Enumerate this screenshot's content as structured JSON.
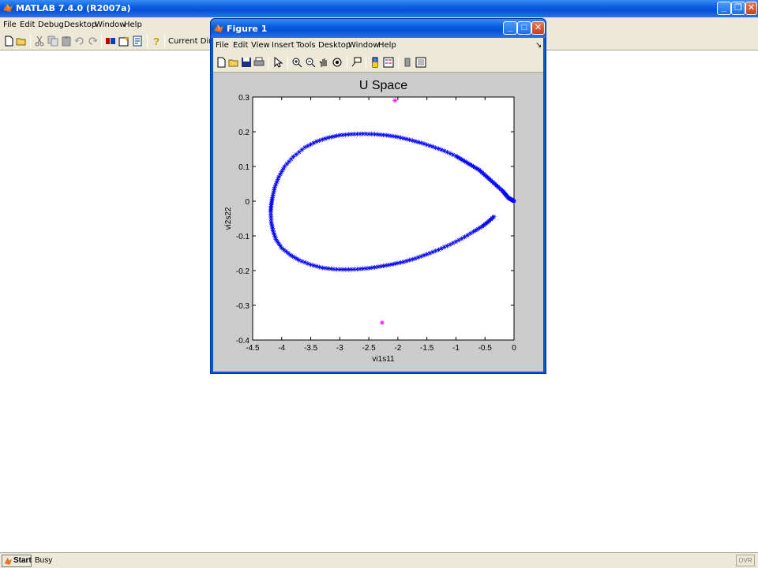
{
  "main_window": {
    "title": "MATLAB  7.4.0 (R2007a)",
    "menu": [
      "File",
      "Edit",
      "Debug",
      "Desktop",
      "Window",
      "Help"
    ],
    "current_directory_label": "Current Directo",
    "toolbar_icons": [
      "new-file-icon",
      "open-folder-icon",
      "cut-icon",
      "copy-icon",
      "paste-icon",
      "undo-icon",
      "redo-icon",
      "simulink-icon",
      "guide-icon",
      "profiler-icon",
      "help-icon"
    ]
  },
  "status_bar": {
    "start_label": "Start",
    "status": "Busy",
    "ovr": "OVR"
  },
  "figure_window": {
    "title": "Figure 1",
    "menu": [
      "File",
      "Edit",
      "View",
      "Insert",
      "Tools",
      "Desktop",
      "Window",
      "Help"
    ],
    "dock_glyph": "↘",
    "toolbar_icons": [
      "new-figure-icon",
      "open-file-icon",
      "save-icon",
      "print-icon",
      "edit-plot-arrow-icon",
      "zoom-in-icon",
      "zoom-out-icon",
      "pan-hand-icon",
      "rotate-3d-icon",
      "data-cursor-icon",
      "insert-colorbar-icon",
      "insert-legend-icon",
      "hide-plot-tools-icon",
      "show-plot-tools-icon"
    ]
  },
  "chart_data": {
    "type": "scatter",
    "title": "U Space",
    "xlabel": "vi1s11",
    "ylabel": "vi2s22",
    "xlim": [
      -4.5,
      0
    ],
    "ylim": [
      -0.4,
      0.3
    ],
    "xticks": [
      "-4.5",
      "-4",
      "-3.5",
      "-3",
      "-2.5",
      "-2",
      "-1.5",
      "-1",
      "-0.5",
      "0"
    ],
    "yticks": [
      "-0.4",
      "-0.3",
      "-0.2",
      "-0.1",
      "0",
      "0.1",
      "0.2",
      "0.3"
    ],
    "grid": false,
    "series": [
      {
        "marker": "*",
        "color": "#0000ff",
        "x": [
          0,
          -0.05,
          -0.1,
          -0.15,
          -0.2,
          -0.3,
          -0.4,
          -0.5,
          -0.6,
          -0.7,
          -0.8,
          -0.9,
          -1.0,
          -1.2,
          -1.4,
          -1.6,
          -1.8,
          -2.0,
          -2.2,
          -2.4,
          -2.6,
          -2.8,
          -3.0,
          -3.2,
          -3.4,
          -3.6,
          -3.8,
          -3.95,
          -4.05,
          -4.12,
          -4.16,
          -4.18,
          -4.19,
          -4.18,
          -4.15,
          -4.1,
          -4.0,
          -3.85,
          -3.7,
          -3.5,
          -3.3,
          -3.1,
          -2.9,
          -2.7,
          -2.5,
          -2.3,
          -2.1,
          -1.9,
          -1.7,
          -1.5,
          -1.3,
          -1.1,
          -0.9,
          -0.7,
          -0.55,
          -0.45,
          -0.35
        ],
        "y": [
          0,
          0.005,
          0.01,
          0.02,
          0.03,
          0.045,
          0.06,
          0.075,
          0.09,
          0.1,
          0.11,
          0.12,
          0.13,
          0.145,
          0.157,
          0.168,
          0.177,
          0.185,
          0.19,
          0.193,
          0.194,
          0.193,
          0.19,
          0.183,
          0.172,
          0.155,
          0.128,
          0.1,
          0.07,
          0.04,
          0.01,
          -0.01,
          -0.03,
          -0.06,
          -0.085,
          -0.11,
          -0.135,
          -0.155,
          -0.17,
          -0.183,
          -0.192,
          -0.196,
          -0.197,
          -0.196,
          -0.193,
          -0.188,
          -0.182,
          -0.175,
          -0.165,
          -0.153,
          -0.14,
          -0.125,
          -0.108,
          -0.088,
          -0.073,
          -0.06,
          -0.045
        ]
      },
      {
        "marker": "*",
        "color": "#ff00ff",
        "x": [
          -2.05,
          -2.27
        ],
        "y": [
          0.29,
          -0.35
        ]
      }
    ]
  }
}
